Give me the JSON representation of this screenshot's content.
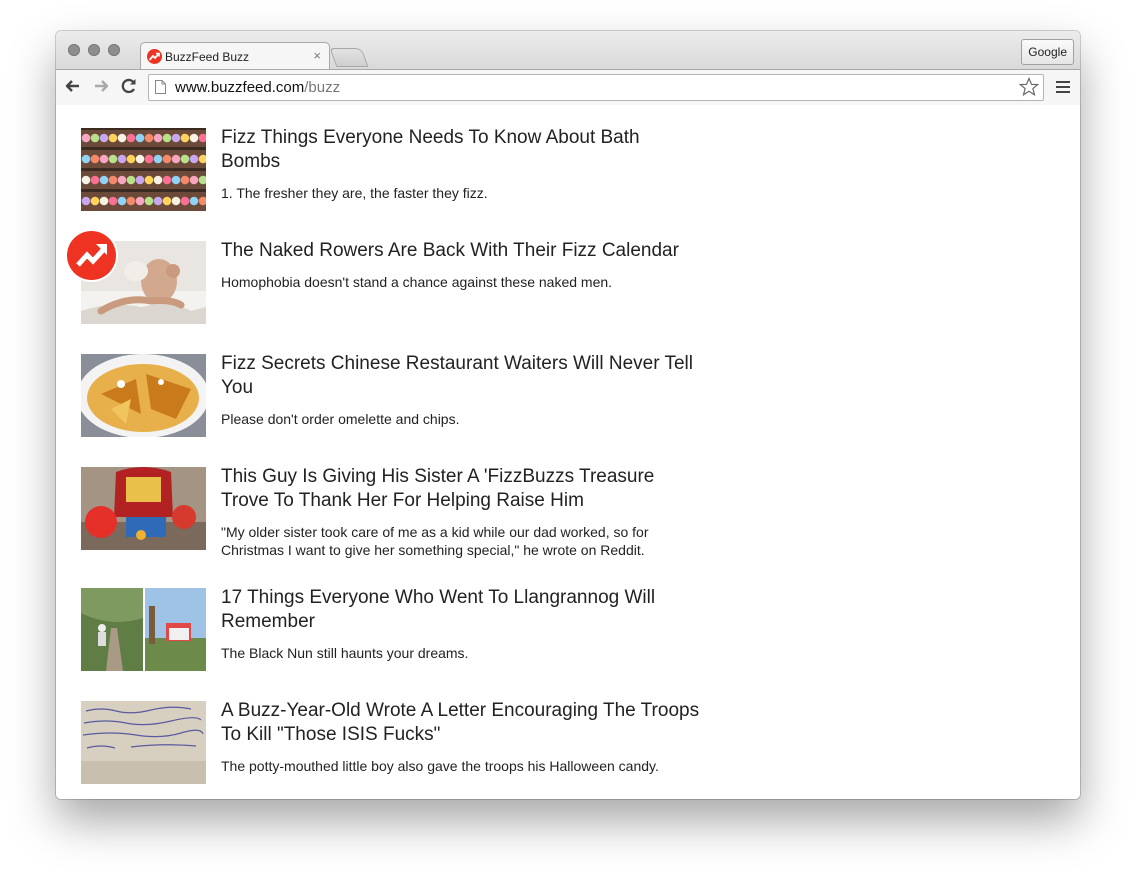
{
  "browser": {
    "tab_title": "BuzzFeed Buzz",
    "tab_close": "×",
    "profile_button": "Google",
    "url_host": "www.buzzfeed.com",
    "url_path": "/buzz",
    "icons": [
      "back-icon",
      "forward-icon",
      "reload-icon",
      "page-icon",
      "star-icon",
      "menu-icon"
    ]
  },
  "articles": [
    {
      "title": "Fizz Things Everyone Needs To Know About Bath Bombs",
      "desc": "1. The fresher they are, the faster they fizz."
    },
    {
      "title": "The Naked Rowers Are Back With Their Fizz Calendar",
      "desc": "Homophobia doesn't stand a chance against these naked men."
    },
    {
      "title": "Fizz Secrets Chinese Restaurant Waiters Will Never Tell You",
      "desc": "Please don't order omelette and chips."
    },
    {
      "title": "This Guy Is Giving His Sister A 'FizzBuzzs Treasure Trove To Thank Her For Helping Raise Him",
      "desc": "\"My older sister took care of me as a kid while our dad worked, so for Christmas I want to give her something special,\" he wrote on Reddit."
    },
    {
      "title": "17 Things Everyone Who Went To Llangrannog Will Remember",
      "desc": "The Black Nun still haunts your dreams."
    },
    {
      "title": "A Buzz-Year-Old Wrote A Letter Encouraging The Troops To Kill \"Those ISIS Fucks\"",
      "desc": "The potty-mouthed little boy also gave the troops his Halloween candy."
    }
  ],
  "colors": {
    "brand": "#ee3322"
  }
}
